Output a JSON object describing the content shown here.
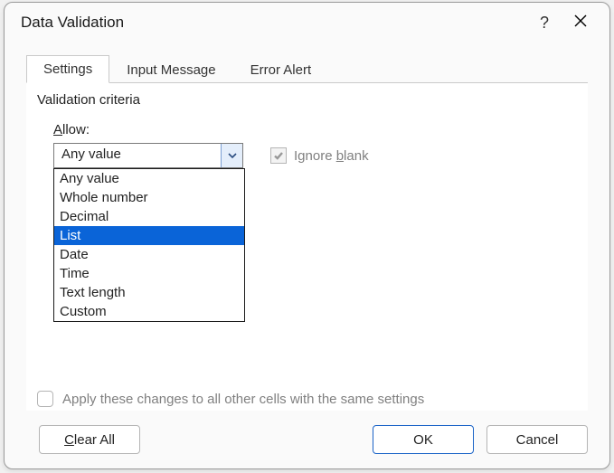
{
  "title": "Data Validation",
  "tabs": {
    "settings": "Settings",
    "input_message": "Input Message",
    "error_alert": "Error Alert"
  },
  "criteria_label": "Validation criteria",
  "allow": {
    "label_pre": "A",
    "label_post": "llow:",
    "value": "Any value",
    "options": [
      "Any value",
      "Whole number",
      "Decimal",
      "List",
      "Date",
      "Time",
      "Text length",
      "Custom"
    ],
    "hovered_index": 3
  },
  "ignore_blank": {
    "checked": true,
    "enabled": false,
    "label_pre": "Ignore ",
    "label_ul": "b",
    "label_post": "lank"
  },
  "apply_all": {
    "checked": false,
    "enabled": false,
    "label_pre": "Apply these changes to all other cells with the same settings",
    "label_ul": "P"
  },
  "footer": {
    "clear_pre": "C",
    "clear_post": "lear All",
    "ok": "OK",
    "cancel": "Cancel"
  }
}
